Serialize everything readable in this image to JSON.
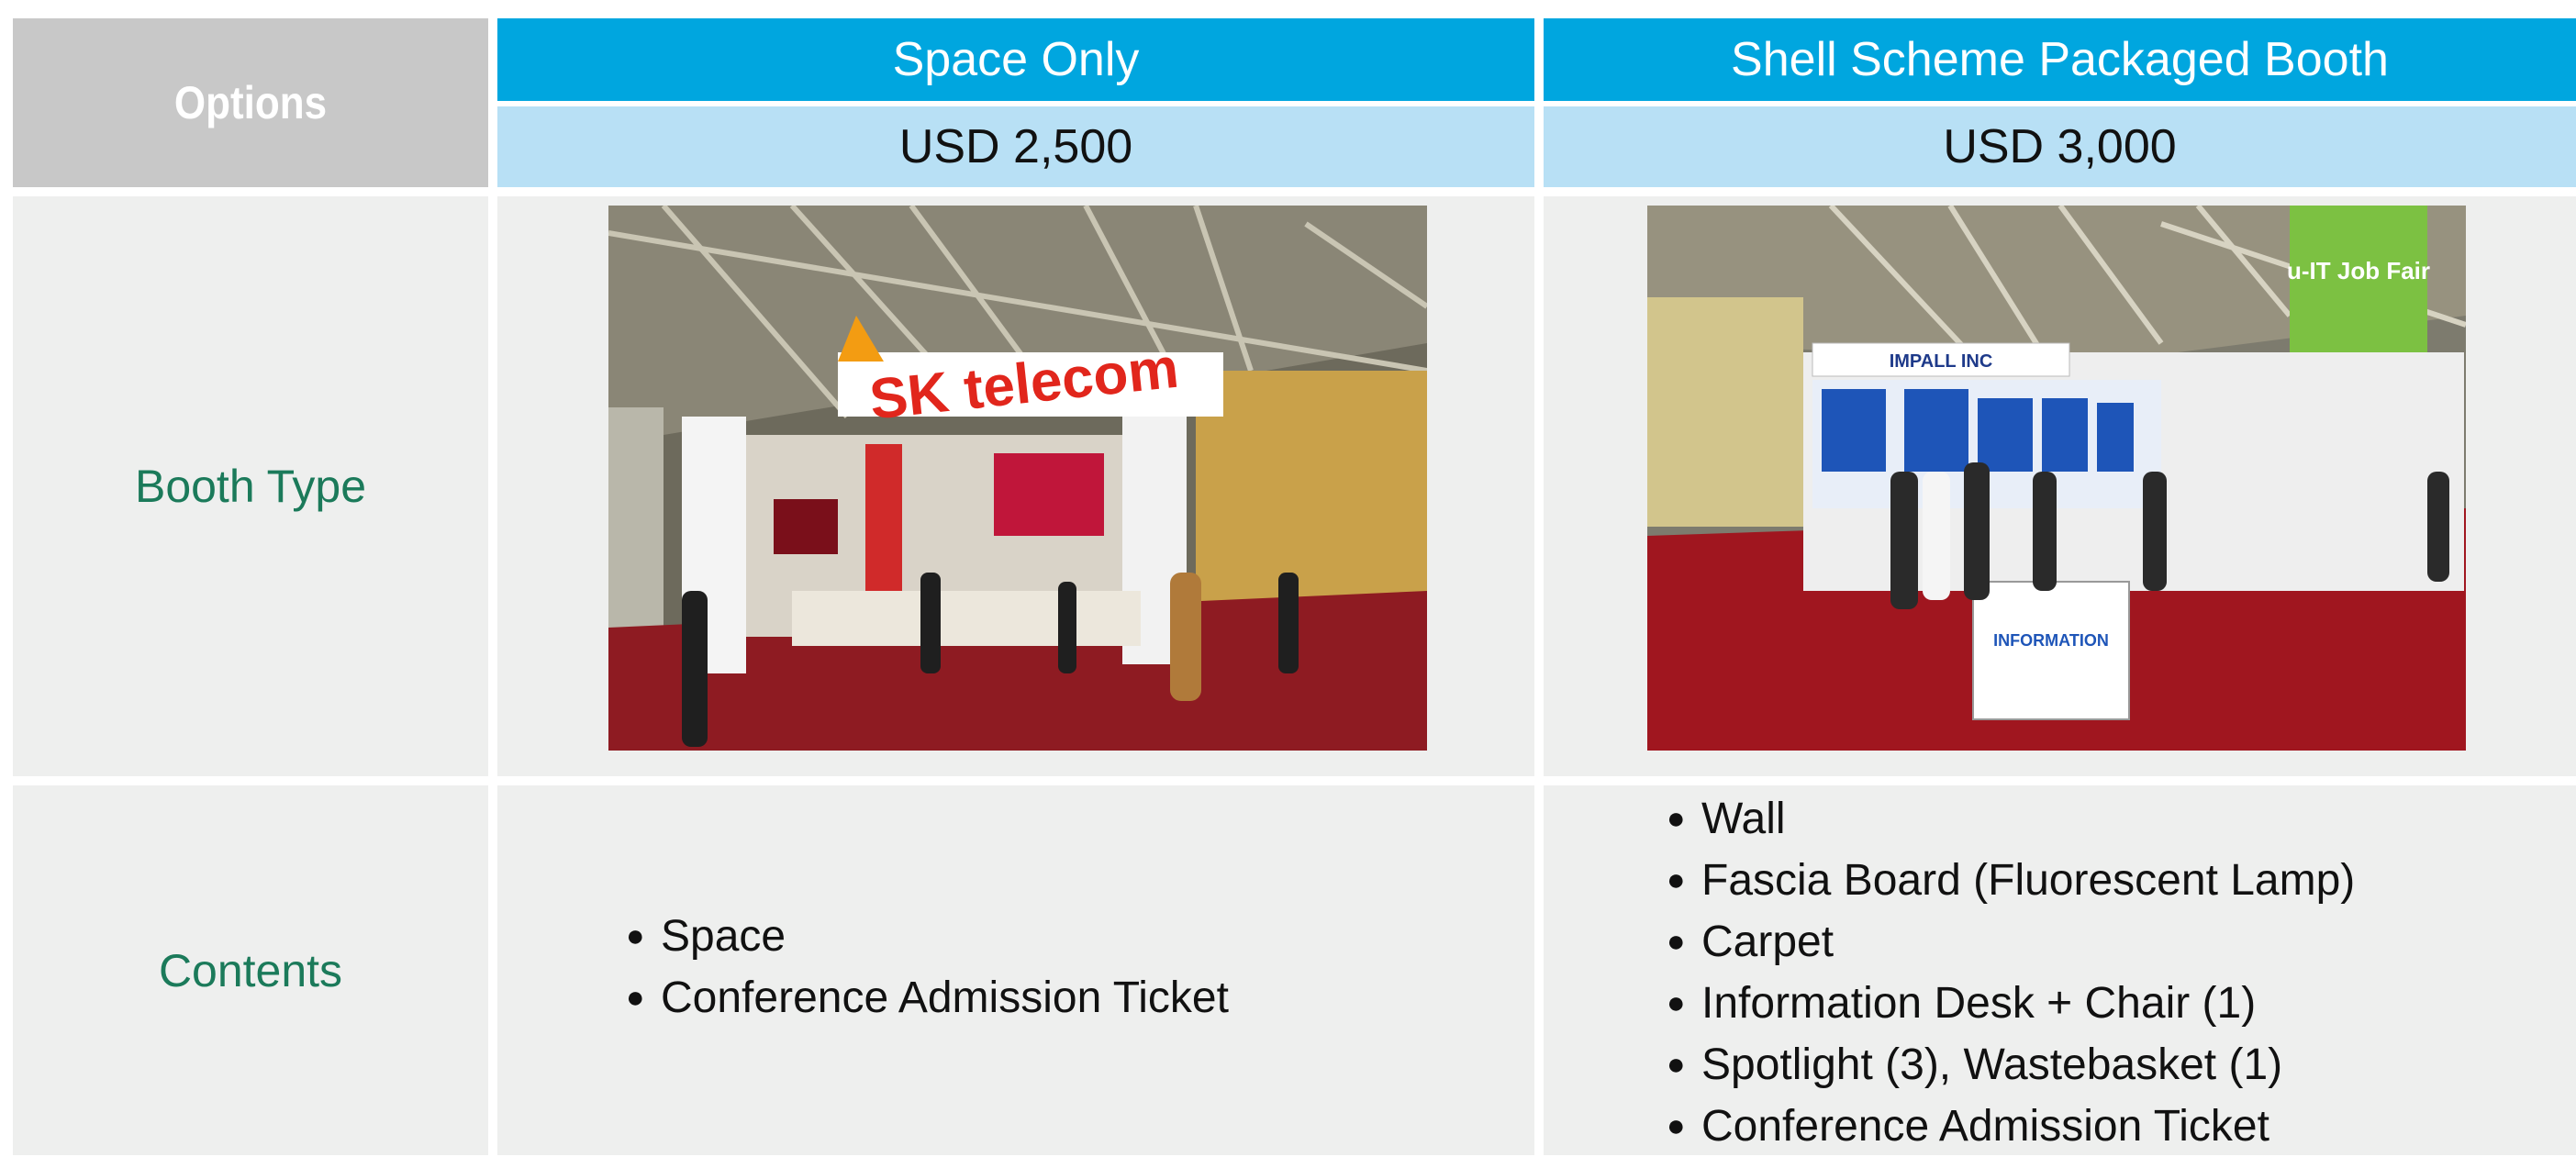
{
  "table": {
    "options_label": "Options",
    "columns": [
      {
        "title": "Space Only",
        "price": "USD 2,500"
      },
      {
        "title": "Shell Scheme Packaged Booth",
        "price": "USD 3,000"
      }
    ],
    "rows": {
      "booth_type_label": "Booth Type",
      "contents_label": "Contents"
    },
    "contents": {
      "space_only": [
        "Space",
        "Conference Admission Ticket"
      ],
      "shell_scheme": [
        "Wall",
        "Fascia Board (Fluorescent Lamp)",
        "Carpet",
        "Information Desk + Chair (1)",
        "Spotlight (3), Wastebasket (1)",
        "Conference Admission Ticket"
      ]
    },
    "photos": {
      "space_only_signage": "SK telecom",
      "shell_banner": "u-IT Job Fair",
      "shell_fascia": "IMPALL INC",
      "shell_desk": "INFORMATION"
    }
  },
  "colors": {
    "header_blue": "#00a6df",
    "price_light_blue": "#b8e0f5",
    "options_gray": "#c8c8c8",
    "cell_gray": "#eeefee",
    "label_green": "#1b7a5a"
  }
}
